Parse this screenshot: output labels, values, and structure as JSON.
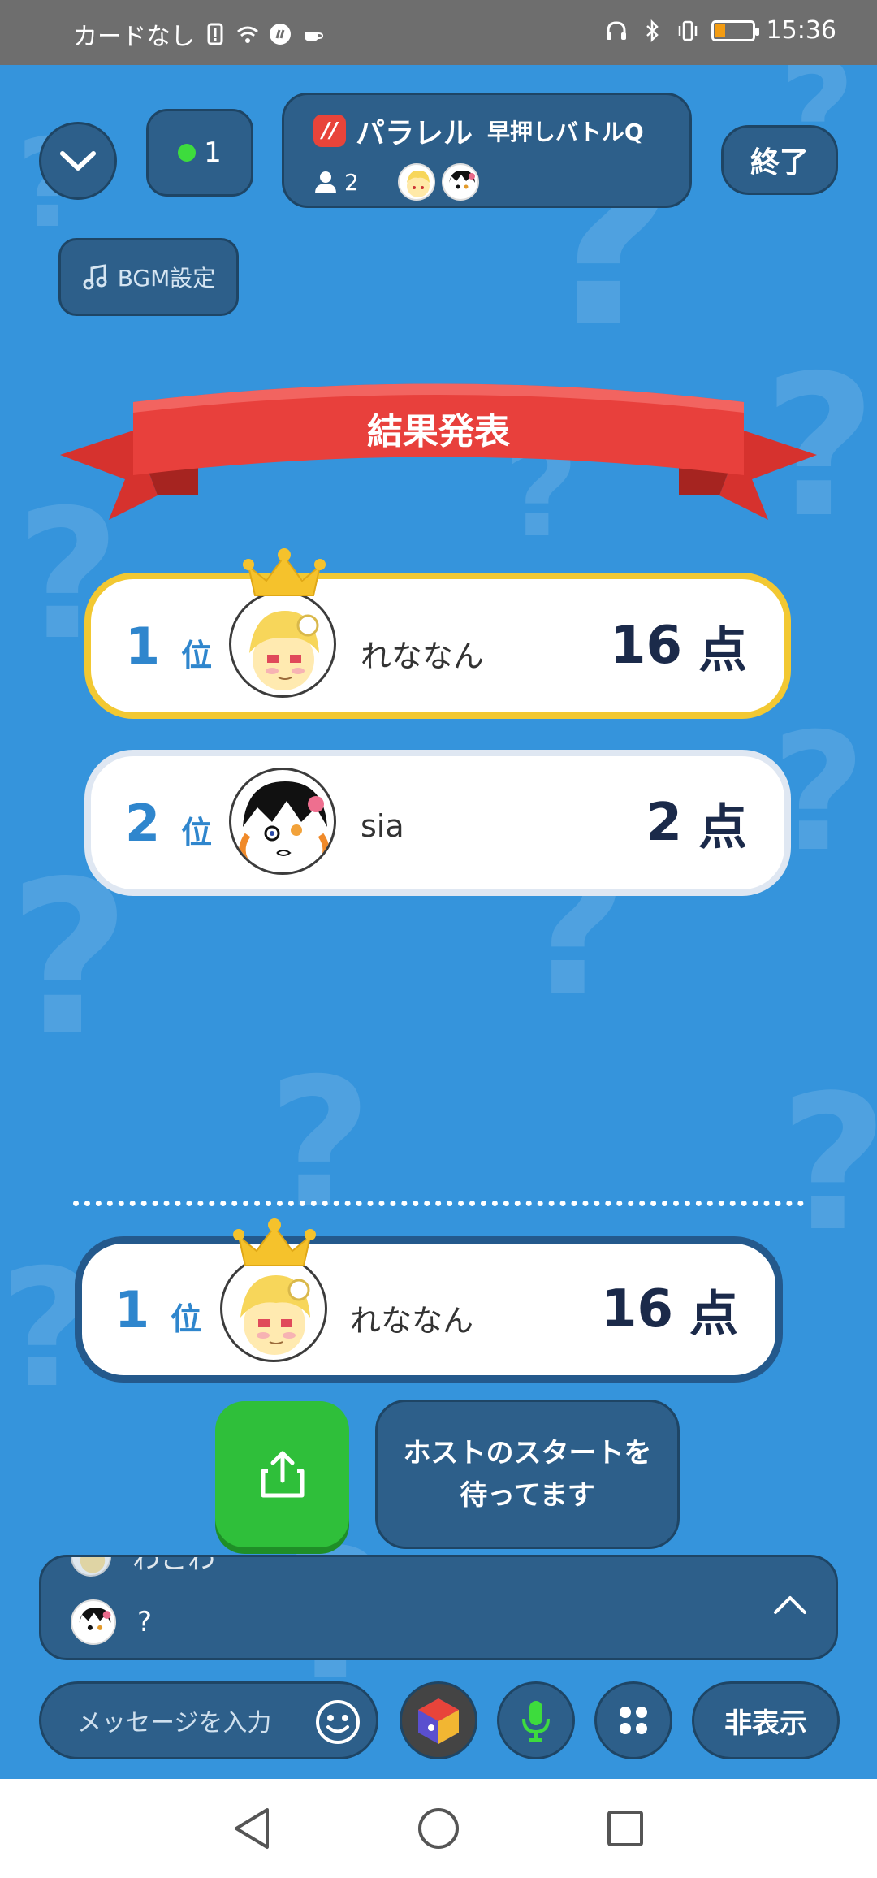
{
  "status_bar": {
    "carrier": "カードなし",
    "time": "15:36",
    "icons": [
      "alert-icon",
      "wifi-icon",
      "app-icon",
      "cup-icon",
      "headset-icon",
      "bluetooth-icon",
      "vibrate-icon",
      "battery-icon"
    ]
  },
  "header": {
    "online_count": "1",
    "brand": "パラレル",
    "game_name": "早押しバトルQ",
    "member_count": "2",
    "end_label": "終了",
    "bgm_label": "BGM設定"
  },
  "results": {
    "banner": "結果発表",
    "rank_suffix": "位",
    "point_suffix": "点",
    "entries": [
      {
        "rank": "1",
        "name": "れななん",
        "score": "16"
      },
      {
        "rank": "2",
        "name": "sia",
        "score": "2"
      }
    ],
    "mine": {
      "rank": "1",
      "name": "れななん",
      "score": "16"
    }
  },
  "actions": {
    "waiting_line1": "ホストのスタートを",
    "waiting_line2": "待ってます"
  },
  "chat": {
    "partial_text": "わこわ",
    "last_message": "?"
  },
  "bottom_bar": {
    "message_placeholder": "メッセージを入力",
    "hide_label": "非表示"
  },
  "colors": {
    "background": "#3594dc",
    "panel": "#2d5f8a",
    "ribbon": "#e8403c",
    "gold": "#f2c832",
    "share_green": "#2fbf3a",
    "rank_blue": "#2f86cd",
    "score_navy": "#1b2a4a"
  }
}
